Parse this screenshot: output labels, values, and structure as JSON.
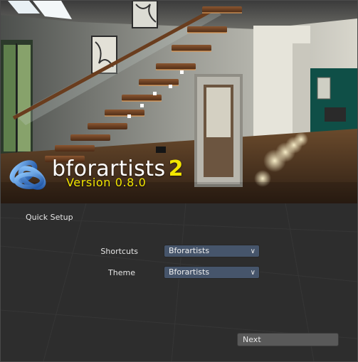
{
  "splash": {
    "brand_name": "bforartists",
    "brand_number": "2",
    "version": "Version 0.8.0"
  },
  "setup": {
    "title": "Quick Setup",
    "shortcuts": {
      "label": "Shortcuts",
      "value": "Bforartists"
    },
    "theme": {
      "label": "Theme",
      "value": "Bforartists"
    },
    "next_label": "Next"
  },
  "colors": {
    "brand_yellow": "#f2e600",
    "dropdown_bg": "#46556b",
    "panel_bg": "#2d2d2d",
    "button_bg": "#595959"
  }
}
